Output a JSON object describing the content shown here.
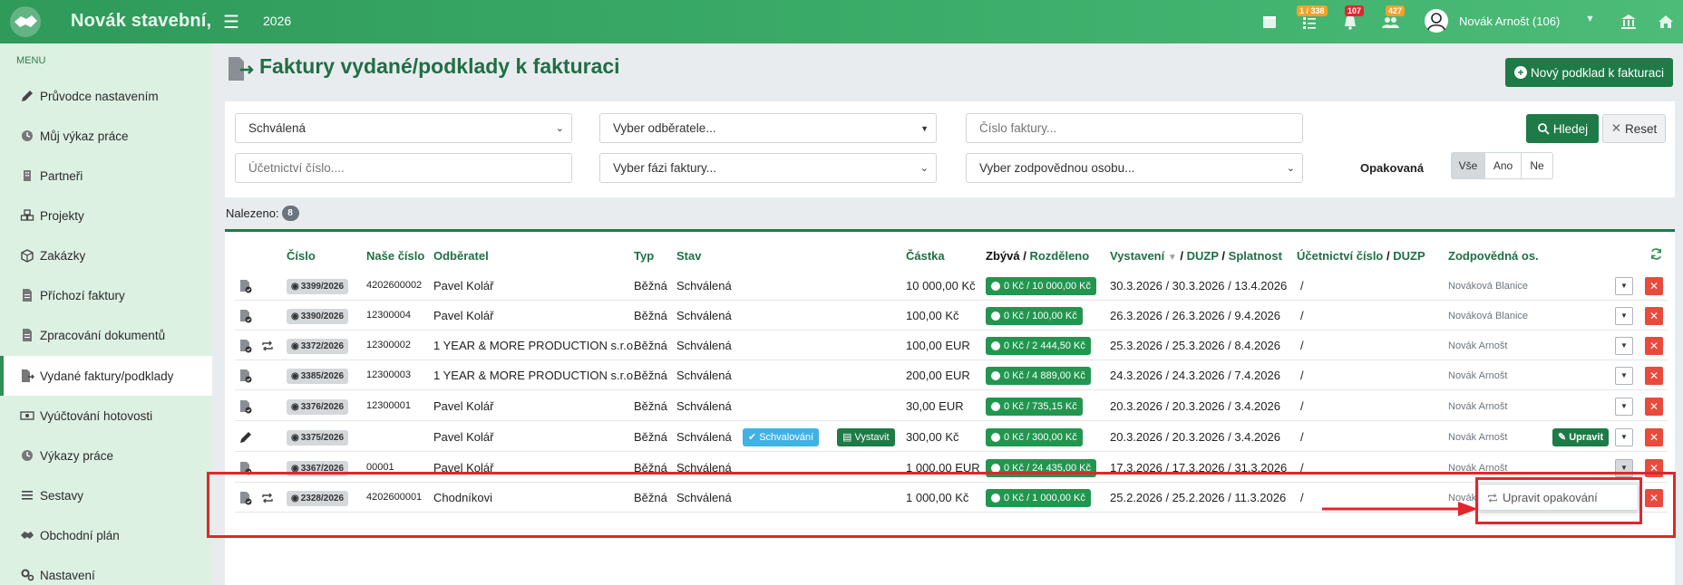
{
  "header": {
    "brand": "Novák stavební,",
    "year": "2026",
    "badges": {
      "tasks": "1 / 338",
      "bell": "107",
      "users": "427"
    },
    "user": "Novák Arnošt (106)",
    "colors": {
      "bar": "#3dae6b",
      "badge_orange": "#f0a22a",
      "badge_red": "#e1262c"
    }
  },
  "sidebar": {
    "heading": "MENU",
    "items": [
      {
        "label": "Průvodce nastavením",
        "icon": "pencil-icon"
      },
      {
        "label": "Můj výkaz práce",
        "icon": "clock-icon"
      },
      {
        "label": "Partneři",
        "icon": "building-icon"
      },
      {
        "label": "Projekty",
        "icon": "cubes-icon"
      },
      {
        "label": "Zakázky",
        "icon": "box-icon"
      },
      {
        "label": "Příchozí faktury",
        "icon": "file-icon"
      },
      {
        "label": "Zpracování dokumentů",
        "icon": "file-icon"
      },
      {
        "label": "Vydané faktury/podklady",
        "icon": "file-export-icon",
        "active": true
      },
      {
        "label": "Vyúčtování hotovosti",
        "icon": "money-icon"
      },
      {
        "label": "Výkazy práce",
        "icon": "clock-icon"
      },
      {
        "label": "Sestavy",
        "icon": "list-icon"
      },
      {
        "label": "Obchodní plán",
        "icon": "handshake-icon"
      },
      {
        "label": "Nastavení",
        "icon": "cogs-icon"
      }
    ]
  },
  "page": {
    "title": "Faktury vydané/podklady k fakturaci",
    "new_button": "Nový podklad k fakturaci"
  },
  "filters": {
    "stav": "Schválená",
    "odberatel_placeholder": "Vyber odběratele...",
    "cislo_placeholder": "Číslo faktury...",
    "ucetni_placeholder": "Účetnictví číslo....",
    "faze_placeholder": "Vyber fázi faktury...",
    "osoba_placeholder": "Vyber zodpovědnou osobu...",
    "search": "Hledej",
    "reset": "Reset",
    "opakovana_label": "Opakovaná",
    "opakovana_options": [
      "Vše",
      "Ano",
      "Ne"
    ],
    "opakovana_selected": "Vše"
  },
  "found": {
    "label": "Nalezeno:",
    "count": "8"
  },
  "table": {
    "headers": {
      "cislo": "Číslo",
      "nase_cislo": "Naše číslo",
      "odberatel": "Odběratel",
      "typ": "Typ",
      "stav": "Stav",
      "castka": "Částka",
      "zbyva": "Zbývá",
      "rozdeleno": "Rozděleno",
      "vystaveni": "Vystavení",
      "duzp": "DUZP",
      "splatnost": "Splatnost",
      "ucetni": "Účetnictví číslo",
      "ucetni_duzp": "DUZP",
      "zodpovedna": "Zodpovědná os.",
      "slash": "/"
    },
    "rows": [
      {
        "cislo": "3399/2026",
        "nase": "4202600002",
        "odberatel": "Pavel Kolář",
        "typ": "Běžná",
        "stav": "Schválená",
        "castka": "10 000,00 Kč",
        "zbyva": "0 Kč / 10 000,00 Kč",
        "data": "30.3.2026 / 30.3.2026 / 13.4.2026",
        "ucetni": "/",
        "osoba": "Nováková Blanice",
        "repeat": false
      },
      {
        "cislo": "3390/2026",
        "nase": "12300004",
        "odberatel": "Pavel Kolář",
        "typ": "Běžná",
        "stav": "Schválená",
        "castka": "100,00 Kč",
        "zbyva": "0 Kč / 100,00 Kč",
        "data": "26.3.2026 / 26.3.2026 / 9.4.2026",
        "ucetni": "/",
        "osoba": "Nováková Blanice",
        "repeat": false
      },
      {
        "cislo": "3372/2026",
        "nase": "12300002",
        "odberatel": "1 YEAR & MORE PRODUCTION s.r.o.",
        "typ": "Běžná",
        "stav": "Schválená",
        "castka": "100,00 EUR",
        "zbyva": "0 Kč / 2 444,50 Kč",
        "data": "25.3.2026 / 25.3.2026 / 8.4.2026",
        "ucetni": "/",
        "osoba": "Novák Arnošt",
        "repeat": true
      },
      {
        "cislo": "3385/2026",
        "nase": "12300003",
        "odberatel": "1 YEAR & MORE PRODUCTION s.r.o.",
        "typ": "Běžná",
        "stav": "Schválená",
        "castka": "200,00 EUR",
        "zbyva": "0 Kč / 4 889,00 Kč",
        "data": "24.3.2026 / 24.3.2026 / 7.4.2026",
        "ucetni": "/",
        "osoba": "Novák Arnošt",
        "repeat": false
      },
      {
        "cislo": "3376/2026",
        "nase": "12300001",
        "odberatel": "Pavel Kolář",
        "typ": "Běžná",
        "stav": "Schválená",
        "castka": "30,00 EUR",
        "zbyva": "0 Kč / 735,15 Kč",
        "data": "20.3.2026 / 20.3.2026 / 3.4.2026",
        "ucetni": "/",
        "osoba": "Novák Arnošt",
        "repeat": false
      },
      {
        "cislo": "3375/2026",
        "nase": "",
        "odberatel": "Pavel Kolář",
        "typ": "Běžná",
        "stav": "Schválená",
        "castka": "300,00 Kč",
        "zbyva": "0 Kč / 300,00 Kč",
        "data": "20.3.2026 / 20.3.2026 / 3.4.2026",
        "ucetni": "/",
        "osoba": "Novák Arnošt",
        "repeat": false,
        "badge_schvalovani": "Schvalování",
        "badge_vystavit": "Vystavit",
        "edit": "Upravit"
      },
      {
        "cislo": "3367/2026",
        "nase": "00001",
        "odberatel": "Pavel Kolář",
        "typ": "Běžná",
        "stav": "Schválená",
        "castka": "1 000,00 EUR",
        "zbyva": "0 Kč / 24 435,00 Kč",
        "data": "17.3.2026 / 17.3.2026 / 31.3.2026",
        "ucetni": "/",
        "osoba": "Novák Arnošt",
        "repeat": false
      },
      {
        "cislo": "2328/2026",
        "nase": "4202600001",
        "odberatel": "Chodníkovi",
        "typ": "Běžná",
        "stav": "Schválená",
        "castka": "1 000,00 Kč",
        "zbyva": "0 Kč / 1 000,00 Kč",
        "data": "25.2.2026 / 25.2.2026 / 11.3.2026",
        "ucetni": "/",
        "osoba": "Novák A",
        "repeat": true
      }
    ]
  },
  "dropdown": {
    "item": "Upravit opakování"
  }
}
